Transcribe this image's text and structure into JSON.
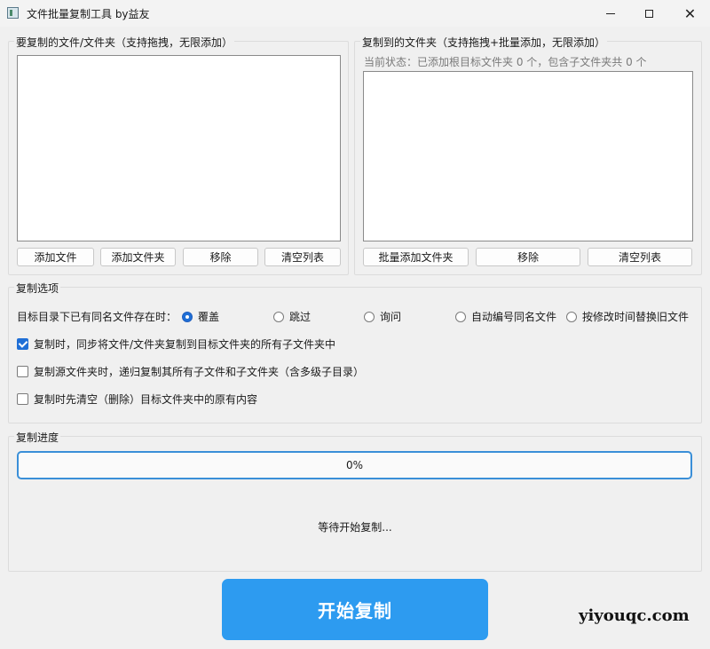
{
  "window": {
    "title": "文件批量复制工具 by益友",
    "minimize": "",
    "maximize": "",
    "close": "✕"
  },
  "source_group": {
    "title": "要复制的文件/文件夹（支持拖拽，无限添加）",
    "items": [],
    "buttons": {
      "add_file": "添加文件",
      "add_folder": "添加文件夹",
      "remove": "移除",
      "clear": "清空列表"
    }
  },
  "target_group": {
    "title": "复制到的文件夹（支持拖拽+批量添加，无限添加）",
    "status": "当前状态：已添加根目标文件夹 0 个，包含子文件夹共 0 个",
    "items": [],
    "buttons": {
      "batch_add_folder": "批量添加文件夹",
      "remove": "移除",
      "clear": "清空列表"
    }
  },
  "options_group": {
    "title": "复制选项",
    "conflict_label": "目标目录下已有同名文件存在时：",
    "conflict_options": [
      {
        "label": "覆盖",
        "selected": true
      },
      {
        "label": "跳过",
        "selected": false
      },
      {
        "label": "询问",
        "selected": false
      },
      {
        "label": "自动编号同名文件",
        "selected": false
      },
      {
        "label": "按修改时间替换旧文件",
        "selected": false
      }
    ],
    "checkboxes": [
      {
        "label": "复制时，同步将文件/文件夹复制到目标文件夹的所有子文件夹中",
        "checked": true
      },
      {
        "label": "复制源文件夹时，递归复制其所有子文件和子文件夹（含多级子目录）",
        "checked": false
      },
      {
        "label": "复制时先清空（删除）目标文件夹中的原有内容",
        "checked": false
      }
    ]
  },
  "progress_group": {
    "title": "复制进度",
    "percent_text": "0%",
    "percent": 0,
    "status": "等待开始复制..."
  },
  "start_button": "开始复制",
  "watermark": "yiyouqc.com",
  "colors": {
    "accent": "#2d9bf0",
    "progress_border": "#3a8fd8",
    "radio_selected": "#1f6fd6"
  }
}
